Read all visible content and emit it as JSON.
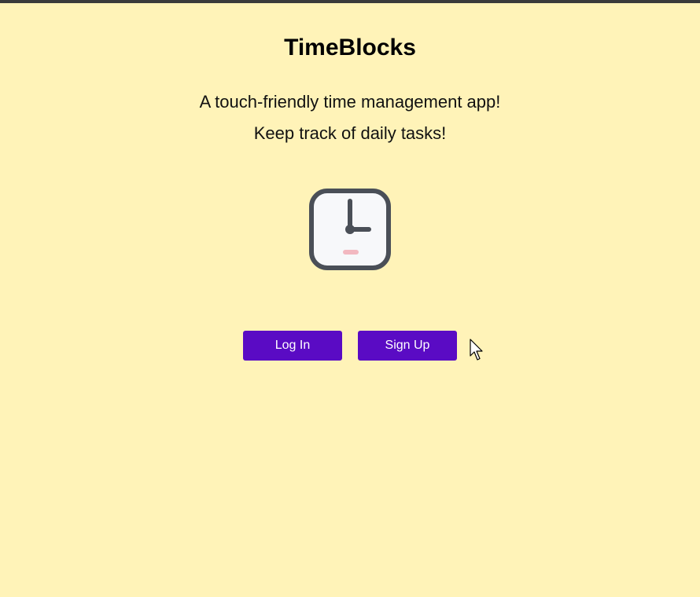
{
  "app": {
    "title": "TimeBlocks",
    "tagline_1": "A touch-friendly time management app!",
    "tagline_2": "Keep track of daily tasks!"
  },
  "logo": {
    "icon": "clock-icon",
    "frame_color": "#4a4f57",
    "face_color": "#f7f8fa",
    "accent_color": "#f2b8c0"
  },
  "buttons": {
    "login_label": "Log In",
    "signup_label": "Sign Up",
    "color": "#5a0bc4"
  },
  "theme": {
    "background": "#fff3b8"
  }
}
